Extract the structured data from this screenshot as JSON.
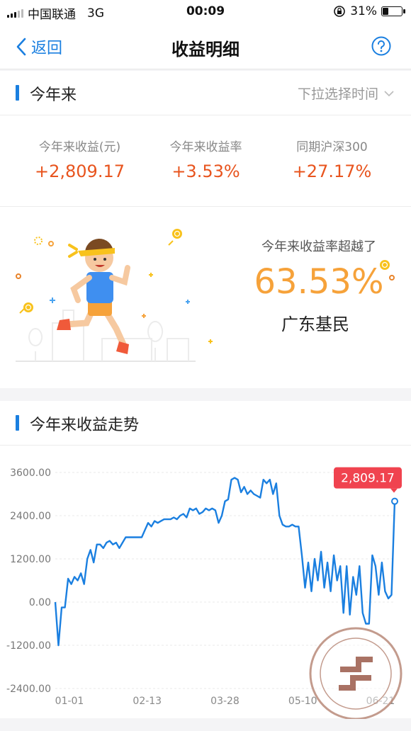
{
  "status_bar": {
    "carrier": "中国联通",
    "network": "3G",
    "time": "00:09",
    "battery_pct": "31%",
    "battery_level": 0.31
  },
  "nav": {
    "back_label": "返回",
    "title": "收益明细"
  },
  "period": {
    "label": "今年来",
    "picker_label": "下拉选择时间"
  },
  "stats": [
    {
      "caption": "今年来收益(元)",
      "value": "+2,809.17"
    },
    {
      "caption": "今年来收益率",
      "value": "+3.53%"
    },
    {
      "caption": "同期沪深300",
      "value": "+27.17%"
    }
  ],
  "beat": {
    "caption": "今年来收益率超越了",
    "percent": "63.53%",
    "region": "广东基民"
  },
  "trend": {
    "title": "今年来收益走势"
  },
  "colors": {
    "accent": "#1a7fe0",
    "gain": "#e8541e",
    "highlight": "#f6a23a",
    "tooltip": "#f0434f"
  },
  "chart_data": {
    "type": "line",
    "tooltip": "2,809.17",
    "y_ticks": [
      "3600.00",
      "2400.00",
      "1200.00",
      "0.00",
      "-1200.00",
      "-2400.00"
    ],
    "x_ticks": [
      "01-01",
      "02-13",
      "03-28",
      "05-10",
      "06-21"
    ],
    "ylim": [
      -2400,
      3600
    ],
    "grid": true,
    "series": [
      {
        "values": [
          0,
          -1200,
          -150,
          -150,
          650,
          500,
          700,
          600,
          800,
          500,
          1200,
          1450,
          1100,
          1600,
          1600,
          1500,
          1650,
          1700,
          1600,
          1650,
          1500,
          1650,
          1800,
          1800,
          1800,
          1800,
          1800,
          1800,
          2000,
          2200,
          2100,
          2250,
          2200,
          2250,
          2300,
          2300,
          2300,
          2350,
          2300,
          2400,
          2450,
          2350,
          2600,
          2550,
          2600,
          2450,
          2500,
          2600,
          2550,
          2600,
          2550,
          2200,
          2400,
          2800,
          2850,
          3400,
          3450,
          3400,
          3050,
          3200,
          3000,
          3100,
          3000,
          2950,
          2900,
          3400,
          3300,
          3400,
          3000,
          3300,
          2400,
          2150,
          2100,
          2100,
          2150,
          2100,
          2100,
          1300,
          400,
          1100,
          300,
          1200,
          600,
          1400,
          400,
          1100,
          300,
          1300,
          600,
          1000,
          -300,
          1000,
          -350,
          700,
          200,
          1000,
          -300,
          -600,
          -600,
          1300,
          1000,
          200,
          1100,
          300,
          100,
          200,
          2800
        ]
      }
    ]
  }
}
